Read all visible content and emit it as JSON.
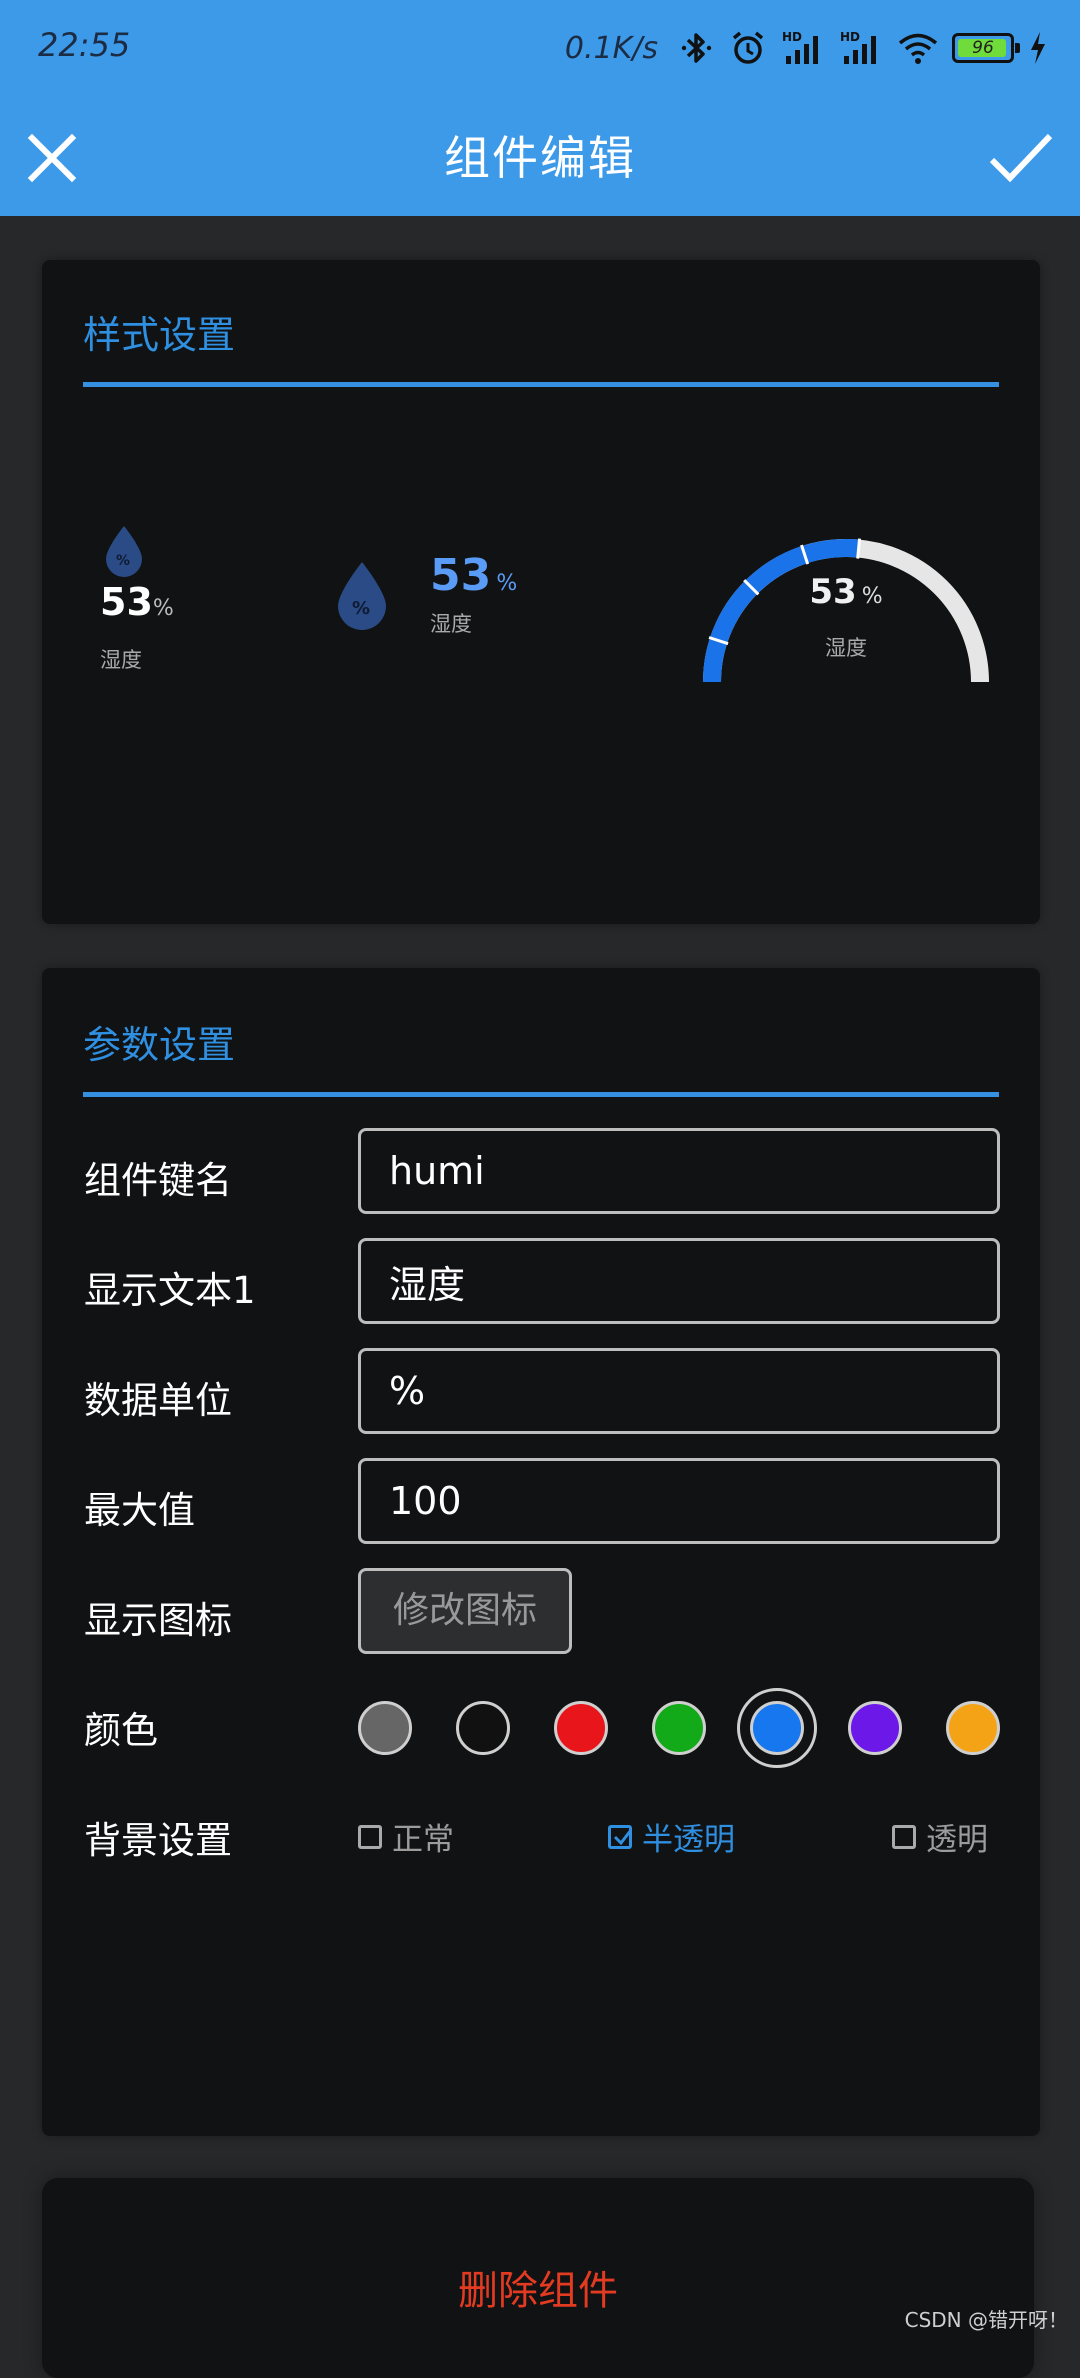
{
  "status_bar": {
    "time": "22:55",
    "net_speed": "0.1K/s",
    "battery_level": "96",
    "battery_percent": 96
  },
  "app_bar": {
    "title": "组件编辑",
    "close_icon": "close-icon",
    "confirm_icon": "check-icon"
  },
  "style_section": {
    "title": "样式设置",
    "previews": [
      {
        "value": "53",
        "unit": "%",
        "label": "湿度",
        "icon": "humidity-drop-icon",
        "value_color": "#ffffff"
      },
      {
        "value": "53",
        "unit": "%",
        "label": "湿度",
        "icon": "humidity-drop-icon",
        "value_color": "#5a9cf5"
      },
      {
        "value": "53",
        "unit": "%",
        "label": "湿度",
        "gauge_fraction": 0.53,
        "gauge_color": "#1a73e8",
        "track_color": "#e6e6e6"
      }
    ]
  },
  "param_section": {
    "title": "参数设置",
    "key_name": {
      "label": "组件键名",
      "value": "humi"
    },
    "display_text": {
      "label": "显示文本1",
      "value": "湿度"
    },
    "data_unit": {
      "label": "数据单位",
      "value": "%"
    },
    "max_value": {
      "label": "最大值",
      "value": "100"
    },
    "display_icon": {
      "label": "显示图标",
      "button": "修改图标"
    },
    "color": {
      "label": "颜色",
      "swatches": [
        "#666666",
        "#111111",
        "#e8161b",
        "#12aa18",
        "#1677ee",
        "#6b18e8",
        "#f5a316"
      ],
      "selected_index": 4
    },
    "background": {
      "label": "背景设置",
      "options": [
        "正常",
        "半透明",
        "透明"
      ],
      "selected": "半透明"
    }
  },
  "delete_button": "删除组件",
  "watermark": "CSDN @错开呀！"
}
